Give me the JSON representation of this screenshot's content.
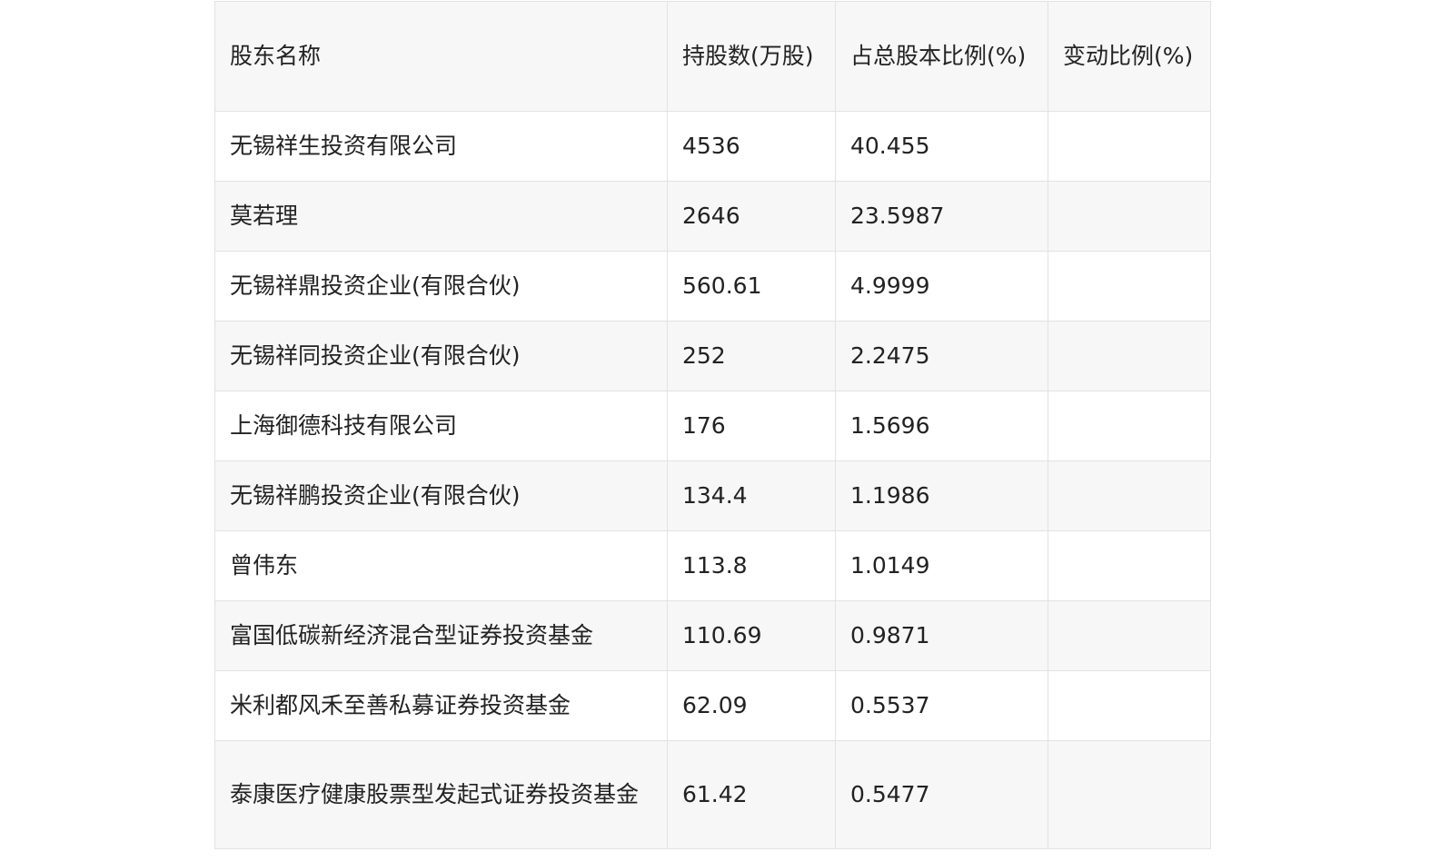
{
  "table": {
    "headers": {
      "name": "股东名称",
      "shares": "持股数(万股)",
      "ratio": "占总股本比例(%)",
      "change": "变动比例(%)"
    },
    "rows": [
      {
        "name": "无锡祥生投资有限公司",
        "shares": "4536",
        "ratio": "40.455",
        "change": ""
      },
      {
        "name": "莫若理",
        "shares": "2646",
        "ratio": "23.5987",
        "change": ""
      },
      {
        "name": "无锡祥鼎投资企业(有限合伙)",
        "shares": "560.61",
        "ratio": "4.9999",
        "change": ""
      },
      {
        "name": "无锡祥同投资企业(有限合伙)",
        "shares": "252",
        "ratio": "2.2475",
        "change": ""
      },
      {
        "name": "上海御德科技有限公司",
        "shares": "176",
        "ratio": "1.5696",
        "change": ""
      },
      {
        "name": "无锡祥鹏投资企业(有限合伙)",
        "shares": "134.4",
        "ratio": "1.1986",
        "change": ""
      },
      {
        "name": "曾伟东",
        "shares": "113.8",
        "ratio": "1.0149",
        "change": ""
      },
      {
        "name": "富国低碳新经济混合型证券投资基金",
        "shares": "110.69",
        "ratio": "0.9871",
        "change": ""
      },
      {
        "name": "米利都风禾至善私募证券投资基金",
        "shares": "62.09",
        "ratio": "0.5537",
        "change": ""
      },
      {
        "name": "泰康医疗健康股票型发起式证券投资基金",
        "shares": "61.42",
        "ratio": "0.5477",
        "change": ""
      }
    ]
  }
}
